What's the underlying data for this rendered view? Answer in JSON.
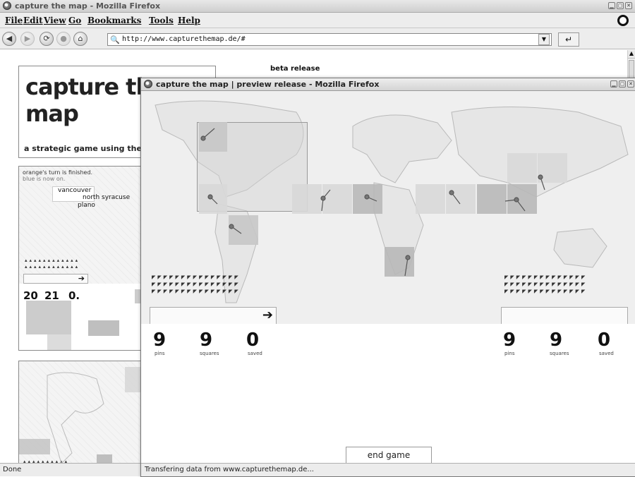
{
  "window": {
    "title": "capture the map - Mozilla Firefox"
  },
  "menu": {
    "items": [
      "File",
      "Edit",
      "View",
      "Go",
      "Bookmarks",
      "Tools",
      "Help"
    ]
  },
  "nav": {
    "url": "http://www.capturethemap.de/#"
  },
  "page": {
    "heading": "capture the map",
    "badge": "beta release",
    "subtitle": "a strategic game using the go",
    "turn_line1": "orange's turn is finished.",
    "turn_line2": "blue is now on.",
    "city_labels": [
      "vancouver",
      "north syracuse",
      "plano"
    ],
    "left_stats": {
      "pins": "20",
      "squares": "21",
      "saved": "0."
    }
  },
  "popup": {
    "title": "capture the map | preview release - Mozilla Firefox",
    "left": {
      "pins": "9",
      "squares": "9",
      "saved": "0",
      "arrow": "➔"
    },
    "right": {
      "pins": "9",
      "squares": "9",
      "saved": "0"
    },
    "labels": {
      "pins": "pins",
      "squares": "squares",
      "saved": "saved"
    },
    "end_game": "end game",
    "status": "Transfering data from www.capturethemap.de..."
  },
  "status": {
    "text": "Done"
  }
}
